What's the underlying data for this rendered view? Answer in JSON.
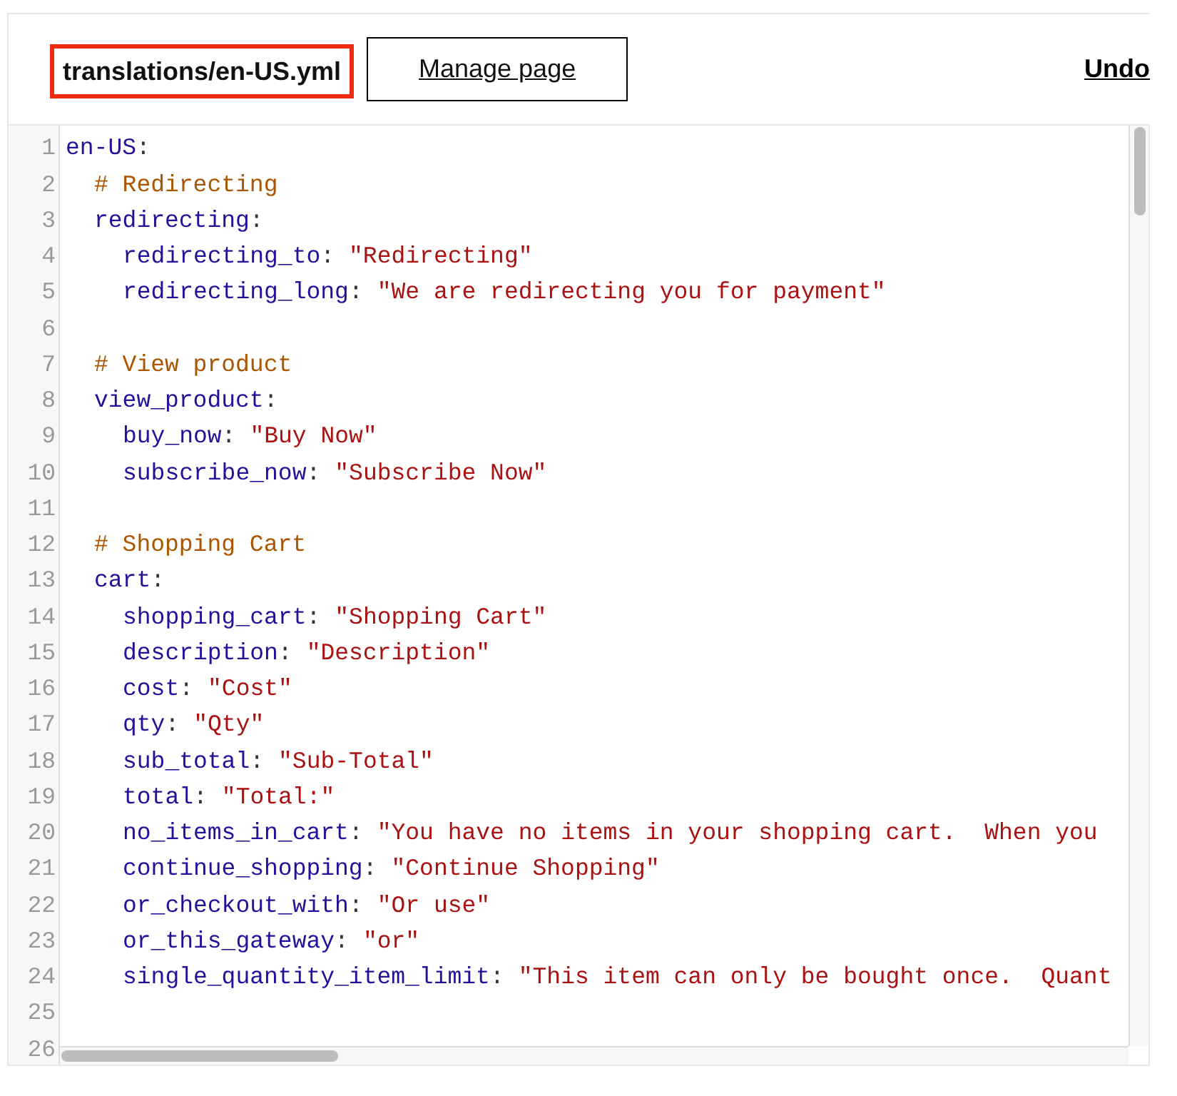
{
  "header": {
    "file_name": "translations/en-US.yml",
    "manage_button": "Manage page",
    "undo_link": "Undo"
  },
  "editor": {
    "lines": [
      {
        "number": "1",
        "kind": "key",
        "key": "en-US",
        "punct": ":",
        "children": [
          {
            "number": "2",
            "kind": "comment",
            "text": "# Redirecting"
          },
          {
            "number": "3",
            "kind": "key",
            "key": "redirecting",
            "punct": ":",
            "children": [
              {
                "number": "4",
                "kind": "pair",
                "key": "redirecting_to",
                "punct": ":",
                "value": "\"Redirecting\""
              },
              {
                "number": "5",
                "kind": "pair",
                "key": "redirecting_long",
                "punct": ":",
                "value": "\"We are redirecting you for payment\""
              }
            ]
          },
          {
            "number": "6",
            "kind": "blank"
          },
          {
            "number": "7",
            "kind": "comment",
            "text": "# View product"
          },
          {
            "number": "8",
            "kind": "key",
            "key": "view_product",
            "punct": ":",
            "children": [
              {
                "number": "9",
                "kind": "pair",
                "key": "buy_now",
                "punct": ":",
                "value": "\"Buy Now\""
              },
              {
                "number": "10",
                "kind": "pair",
                "key": "subscribe_now",
                "punct": ":",
                "value": "\"Subscribe Now\""
              }
            ]
          },
          {
            "number": "11",
            "kind": "blank"
          },
          {
            "number": "12",
            "kind": "comment",
            "text": "# Shopping Cart"
          },
          {
            "number": "13",
            "kind": "key",
            "key": "cart",
            "punct": ":",
            "children": [
              {
                "number": "14",
                "kind": "pair",
                "key": "shopping_cart",
                "punct": ":",
                "value": "\"Shopping Cart\""
              },
              {
                "number": "15",
                "kind": "pair",
                "key": "description",
                "punct": ":",
                "value": "\"Description\""
              },
              {
                "number": "16",
                "kind": "pair",
                "key": "cost",
                "punct": ":",
                "value": "\"Cost\""
              },
              {
                "number": "17",
                "kind": "pair",
                "key": "qty",
                "punct": ":",
                "value": "\"Qty\""
              },
              {
                "number": "18",
                "kind": "pair",
                "key": "sub_total",
                "punct": ":",
                "value": "\"Sub-Total\""
              },
              {
                "number": "19",
                "kind": "pair",
                "key": "total",
                "punct": ":",
                "value": "\"Total:\""
              },
              {
                "number": "20",
                "kind": "pair",
                "key": "no_items_in_cart",
                "punct": ":",
                "value": "\"You have no items in your shopping cart.  When you"
              },
              {
                "number": "21",
                "kind": "pair",
                "key": "continue_shopping",
                "punct": ":",
                "value": "\"Continue Shopping\""
              },
              {
                "number": "22",
                "kind": "pair",
                "key": "or_checkout_with",
                "punct": ":",
                "value": "\"Or use\""
              },
              {
                "number": "23",
                "kind": "pair",
                "key": "or_this_gateway",
                "punct": ":",
                "value": "\"or\""
              },
              {
                "number": "24",
                "kind": "pair",
                "key": "single_quantity_item_limit",
                "punct": ":",
                "value": "\"This item can only be bought once.  Quant"
              }
            ]
          },
          {
            "number": "25",
            "kind": "blank"
          },
          {
            "number": "26",
            "kind": "blank"
          }
        ]
      }
    ]
  }
}
